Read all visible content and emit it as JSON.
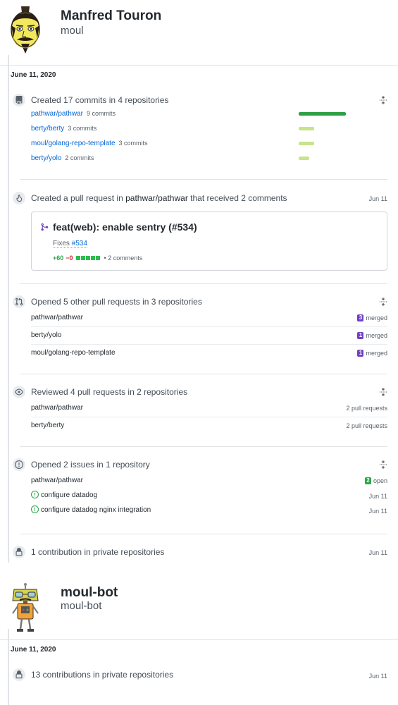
{
  "profile1": {
    "name": "Manfred Touron",
    "login": "moul",
    "date": "June 11, 2020",
    "commits": {
      "title": "Created 17 commits in 4 repositories",
      "repos": [
        {
          "name": "pathwar/pathwar",
          "count": "9 commits",
          "share": 1.0
        },
        {
          "name": "berty/berty",
          "count": "3 commits",
          "share": 0.33
        },
        {
          "name": "moul/golang-repo-template",
          "count": "3 commits",
          "share": 0.33
        },
        {
          "name": "berty/yolo",
          "count": "2 commits",
          "share": 0.22
        }
      ]
    },
    "pr_created": {
      "title_prefix": "Created a pull request in",
      "repo": "pathwar/pathwar",
      "title_suffix": "that received 2 comments",
      "date": "Jun 11",
      "pr_title": "feat(web): enable sentry (#534)",
      "body_text": "Fixes",
      "body_ref": "#534",
      "additions": "+60",
      "deletions": "−0",
      "diff_boxes": 5,
      "comments": "2 comments"
    },
    "opened_prs": {
      "title": "Opened 5 other pull requests in 3 repositories",
      "rows": [
        {
          "repo": "pathwar/pathwar",
          "count": "3",
          "status": "merged"
        },
        {
          "repo": "berty/yolo",
          "count": "1",
          "status": "merged"
        },
        {
          "repo": "moul/golang-repo-template",
          "count": "1",
          "status": "merged"
        }
      ]
    },
    "reviewed": {
      "title": "Reviewed 4 pull requests in 2 repositories",
      "rows": [
        {
          "repo": "pathwar/pathwar",
          "meta": "2 pull requests"
        },
        {
          "repo": "berty/berty",
          "meta": "2 pull requests"
        }
      ]
    },
    "issues": {
      "title": "Opened 2 issues in 1 repository",
      "repo": "pathwar/pathwar",
      "open_count": "2",
      "open_label": "open",
      "items": [
        {
          "title": "configure datadog",
          "date": "Jun 11"
        },
        {
          "title": "configure datadog nginx integration",
          "date": "Jun 11"
        }
      ]
    },
    "private": {
      "title": "1 contribution in private repositories",
      "date": "Jun 11"
    }
  },
  "profile2": {
    "name": "moul-bot",
    "login": "moul-bot",
    "date": "June 11, 2020",
    "private": {
      "title": "13 contributions in private repositories",
      "date": "Jun 11"
    }
  },
  "colors": {
    "link": "#0366d6",
    "bar_strong": "#2ea043",
    "bar_light": "#c6e48b",
    "merged": "#6f42c1",
    "open": "#28a745"
  },
  "icons": [
    "repo-push-icon",
    "flame-icon",
    "git-pull-request-icon",
    "eye-icon",
    "issue-opened-icon",
    "lock-icon",
    "fold-icon",
    "git-merge-icon"
  ]
}
